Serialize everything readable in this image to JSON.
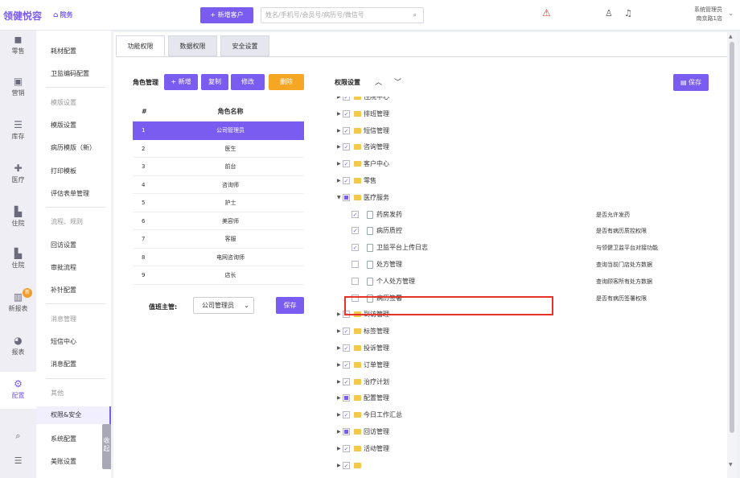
{
  "header": {
    "brand": "领健悦容",
    "home_label": "院务",
    "add_customer": "+ 新增客户",
    "search_placeholder": "姓名/手机号/会员号/病历号/微信号",
    "account_name": "系统管理员",
    "account_store": "南京路1店"
  },
  "leftnav": [
    {
      "label": "零售",
      "icon": "bag-icon"
    },
    {
      "label": "营销",
      "icon": "bookmark-icon"
    },
    {
      "label": "库存",
      "icon": "stack-icon"
    },
    {
      "label": "医疗",
      "icon": "medkit-icon"
    },
    {
      "label": "住院",
      "icon": "bed-icon"
    },
    {
      "label": "住院",
      "icon": "bed-icon"
    },
    {
      "label": "新报表",
      "icon": "chart-icon",
      "badge": "新"
    },
    {
      "label": "报表",
      "icon": "pie-icon"
    },
    {
      "label": "配置",
      "icon": "gear-icon",
      "active": true
    }
  ],
  "subnav": [
    {
      "label": "耗材配置"
    },
    {
      "label": "卫监编码配置"
    },
    {
      "label": "模版设置",
      "group": true
    },
    {
      "label": "模版设置"
    },
    {
      "label": "病历模版（新）"
    },
    {
      "label": "打印模板"
    },
    {
      "label": "评估表单管理"
    },
    {
      "label": "流程、规则",
      "group": true
    },
    {
      "label": "回访设置"
    },
    {
      "label": "审批流程"
    },
    {
      "label": "补针配置"
    },
    {
      "label": "消息管理",
      "group": true
    },
    {
      "label": "短信中心"
    },
    {
      "label": "消息配置"
    },
    {
      "label": "其他",
      "group": true
    },
    {
      "label": "权限&安全",
      "active": true
    },
    {
      "label": "系统配置"
    },
    {
      "label": "美账设置"
    }
  ],
  "collapse_label": "收起",
  "tabs": [
    "功能权限",
    "数据权限",
    "安全设置"
  ],
  "role_panel": {
    "title": "角色管理",
    "buttons": {
      "add": "+ 新增",
      "copy": "复制",
      "edit": "修改",
      "delete": "删除"
    },
    "col_num": "#",
    "col_name": "角色名称",
    "rows": [
      {
        "n": "1",
        "name": "公司管理员",
        "selected": true
      },
      {
        "n": "2",
        "name": "医生"
      },
      {
        "n": "3",
        "name": "前台"
      },
      {
        "n": "4",
        "name": "咨询师"
      },
      {
        "n": "5",
        "name": "护士"
      },
      {
        "n": "6",
        "name": "美容师"
      },
      {
        "n": "7",
        "name": "客服"
      },
      {
        "n": "8",
        "name": "电网咨询师"
      },
      {
        "n": "9",
        "name": "店长"
      }
    ],
    "duty_label": "值班主管:",
    "duty_value": "公司管理员",
    "duty_save": "保存"
  },
  "perm_panel": {
    "title": "权限设置",
    "save": "保存",
    "nodes": [
      {
        "label": "住院中心",
        "state": "checked"
      },
      {
        "label": "排班管理",
        "state": "checked"
      },
      {
        "label": "短信管理",
        "state": "checked"
      },
      {
        "label": "咨询管理",
        "state": "checked"
      },
      {
        "label": "客户中心",
        "state": "checked"
      },
      {
        "label": "零售",
        "state": "checked"
      },
      {
        "label": "医疗服务",
        "state": "partial",
        "expanded": true
      },
      {
        "label": "药房发药",
        "state": "checked",
        "child": true,
        "desc": "是否允许发药"
      },
      {
        "label": "病历质控",
        "state": "checked",
        "child": true,
        "desc": "是否有病历质控权限"
      },
      {
        "label": "卫监平台上传日志",
        "state": "checked",
        "child": true,
        "desc": "与领健卫监平台对接功能"
      },
      {
        "label": "处方管理",
        "state": "unchecked",
        "child": true,
        "desc": "查询当前门店处方数据"
      },
      {
        "label": "个人处方管理",
        "state": "unchecked",
        "child": true,
        "desc": "查询顾客所有处方数据"
      },
      {
        "label": "病历签署",
        "state": "unchecked",
        "child": true,
        "desc": "是否有病历签署权限"
      },
      {
        "label": "到访管理",
        "state": "checked"
      },
      {
        "label": "标签管理",
        "state": "checked"
      },
      {
        "label": "投诉管理",
        "state": "checked"
      },
      {
        "label": "订单管理",
        "state": "checked"
      },
      {
        "label": "治疗计划",
        "state": "checked"
      },
      {
        "label": "配置管理",
        "state": "partial"
      },
      {
        "label": "今日工作汇总",
        "state": "checked"
      },
      {
        "label": "回访管理",
        "state": "partial"
      },
      {
        "label": "活动管理",
        "state": "checked"
      },
      {
        "label": "",
        "state": "checked"
      }
    ]
  }
}
